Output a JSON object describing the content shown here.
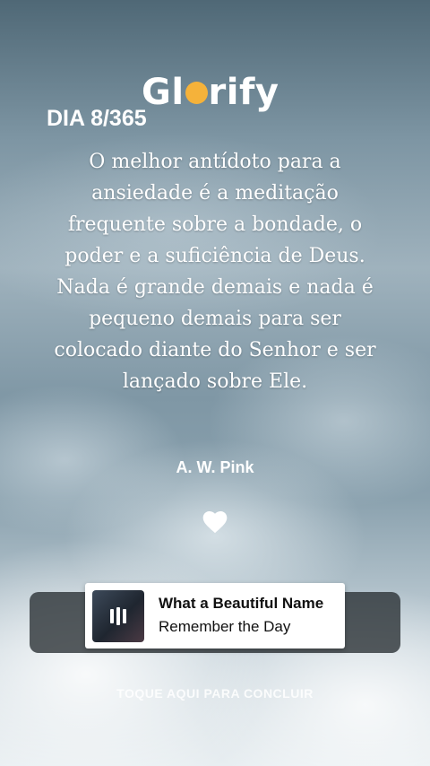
{
  "app": {
    "brand_prefix": "Gl",
    "brand_suffix": "rify",
    "brand_accent_color": "#f5b23a"
  },
  "devotional": {
    "day_label": "DIA 8/365",
    "quote": "O melhor antídoto para a ansiedade é a meditação frequente sobre a bondade, o poder e a suficiência de Deus. Nada é grande demais e nada é pequeno demais para ser colocado diante do Senhor e ser lançado sobre Ele.",
    "author": "A. W. Pink",
    "like_icon": "heart-icon"
  },
  "player": {
    "title": "What a Beautiful Name",
    "subtitle": "Remember the Day",
    "state_icon": "pause-icon"
  },
  "footer": {
    "cta_label": "TOQUE AQUI PARA CONCLUIR"
  }
}
